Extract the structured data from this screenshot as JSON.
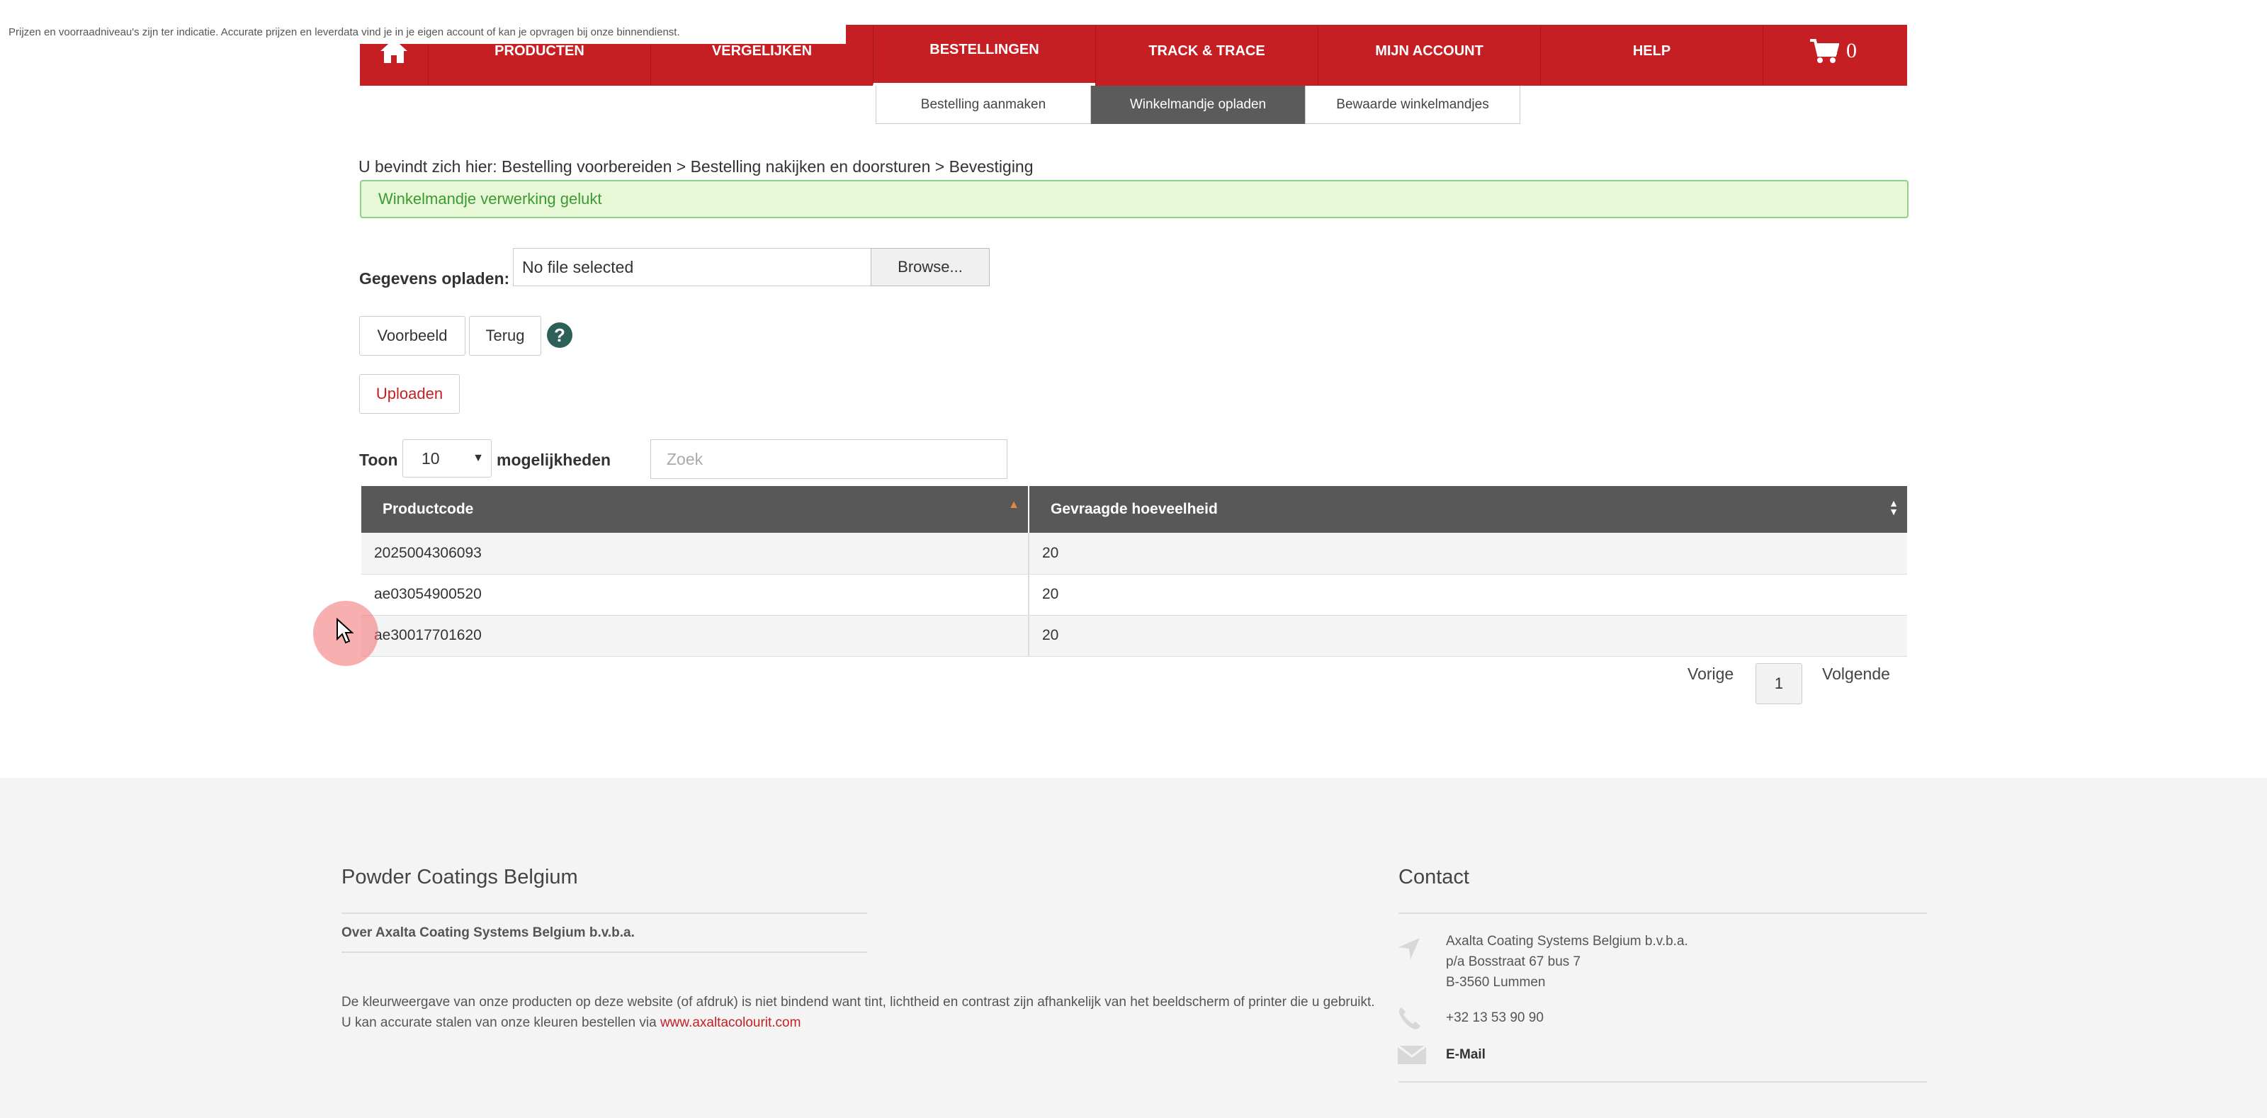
{
  "notice": "Prijzen en voorraadniveau's zijn ter indicatie. Accurate prijzen en leverdata vind je in je eigen account of kan je opvragen bij onze binnendienst.",
  "nav": {
    "home_icon": "home-icon",
    "items": [
      "PRODUCTEN",
      "VERGELIJKEN",
      "BESTELLINGEN",
      "TRACK & TRACE",
      "MIJN ACCOUNT",
      "HELP"
    ],
    "active": "BESTELLINGEN",
    "cart_count": "0",
    "cart_icon": "cart-icon"
  },
  "subnav": {
    "items": [
      "Bestelling aanmaken",
      "Winkelmandje opladen",
      "Bewaarde winkelmandjes"
    ],
    "active": "Winkelmandje opladen"
  },
  "breadcrumb": "U bevindt zich hier: Bestelling voorbereiden > Bestelling nakijken en doorsturen > Bevestiging",
  "alert": "Winkelmandje verwerking gelukt",
  "upload": {
    "label": "Gegevens opladen:",
    "file_value": "No file selected",
    "browse_label": "Browse...",
    "preview_label": "Voorbeeld",
    "back_label": "Terug",
    "help_glyph": "?",
    "upload_label": "Uploaden"
  },
  "table_controls": {
    "show_label": "Toon",
    "page_size": "10",
    "options_label": "mogelijkheden",
    "search_placeholder": "Zoek"
  },
  "table": {
    "headers": [
      "Productcode",
      "Gevraagde hoeveelheid"
    ],
    "rows": [
      [
        "2025004306093",
        "20"
      ],
      [
        "ae03054900520",
        "20"
      ],
      [
        "ae30017701620",
        "20"
      ]
    ]
  },
  "pagination": {
    "prev": "Vorige",
    "current": "1",
    "next": "Volgende"
  },
  "footer": {
    "left_title": "Powder Coatings Belgium",
    "about_link": "Over Axalta Coating Systems Belgium b.v.b.a.",
    "disclaimer": "De kleurweergave van onze producten op deze website (of afdruk) is niet bindend want tint, lichtheid en contrast zijn afhankelijk van het beeldscherm of printer die u gebruikt. U kan accurate stalen van onze kleuren bestellen via",
    "disclaimer_link": "www.axaltacolourit.com",
    "contact_title": "Contact",
    "address_line1": "Axalta Coating Systems Belgium b.v.b.a.",
    "address_line2": "p/a Bosstraat 67 bus 7",
    "address_line3": "B-3560 Lummen",
    "phone": "+32 13 53 90 90",
    "email_label": "E-Mail"
  },
  "colors": {
    "brand_red": "#c51f24",
    "alert_bg": "#e8f7d6",
    "alert_text": "#3c9a35",
    "table_header": "#585858"
  }
}
